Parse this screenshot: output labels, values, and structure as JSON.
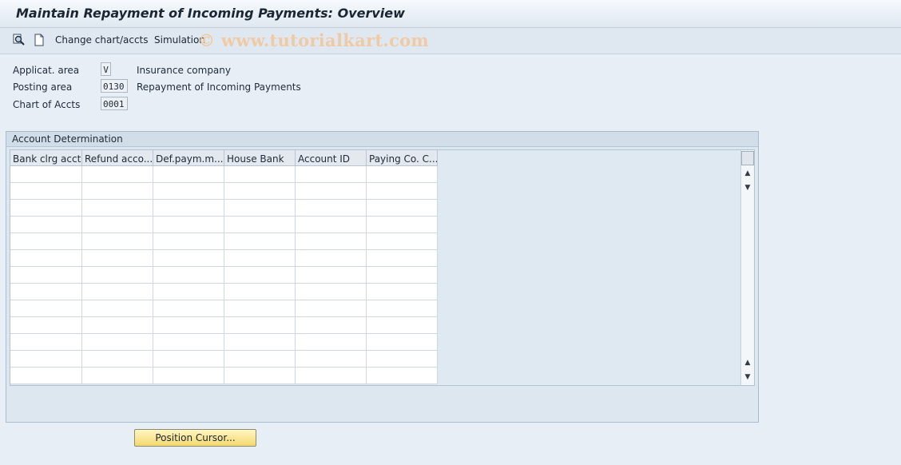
{
  "title": "Maintain Repayment of Incoming Payments: Overview",
  "toolbar": {
    "change_chart_label": "Change chart/accts",
    "simulation_label": "Simulation",
    "watermark": "© www.tutorialkart.com"
  },
  "fields": {
    "applic_area": {
      "label": "Applicat. area",
      "value": "V",
      "desc": "Insurance company"
    },
    "posting_area": {
      "label": "Posting area",
      "value": "0130",
      "desc": "Repayment of Incoming Payments"
    },
    "chart_of_accts": {
      "label": "Chart of Accts",
      "value": "0001"
    }
  },
  "group": {
    "title": "Account Determination",
    "columns": [
      "Bank clrg acct",
      "Refund acco...",
      "Def.paym.m...",
      "House Bank",
      "Account ID",
      "Paying Co. C..."
    ]
  },
  "buttons": {
    "position_cursor": "Position Cursor..."
  },
  "icons": {
    "find": "find-icon",
    "new_doc": "new-document-icon"
  }
}
